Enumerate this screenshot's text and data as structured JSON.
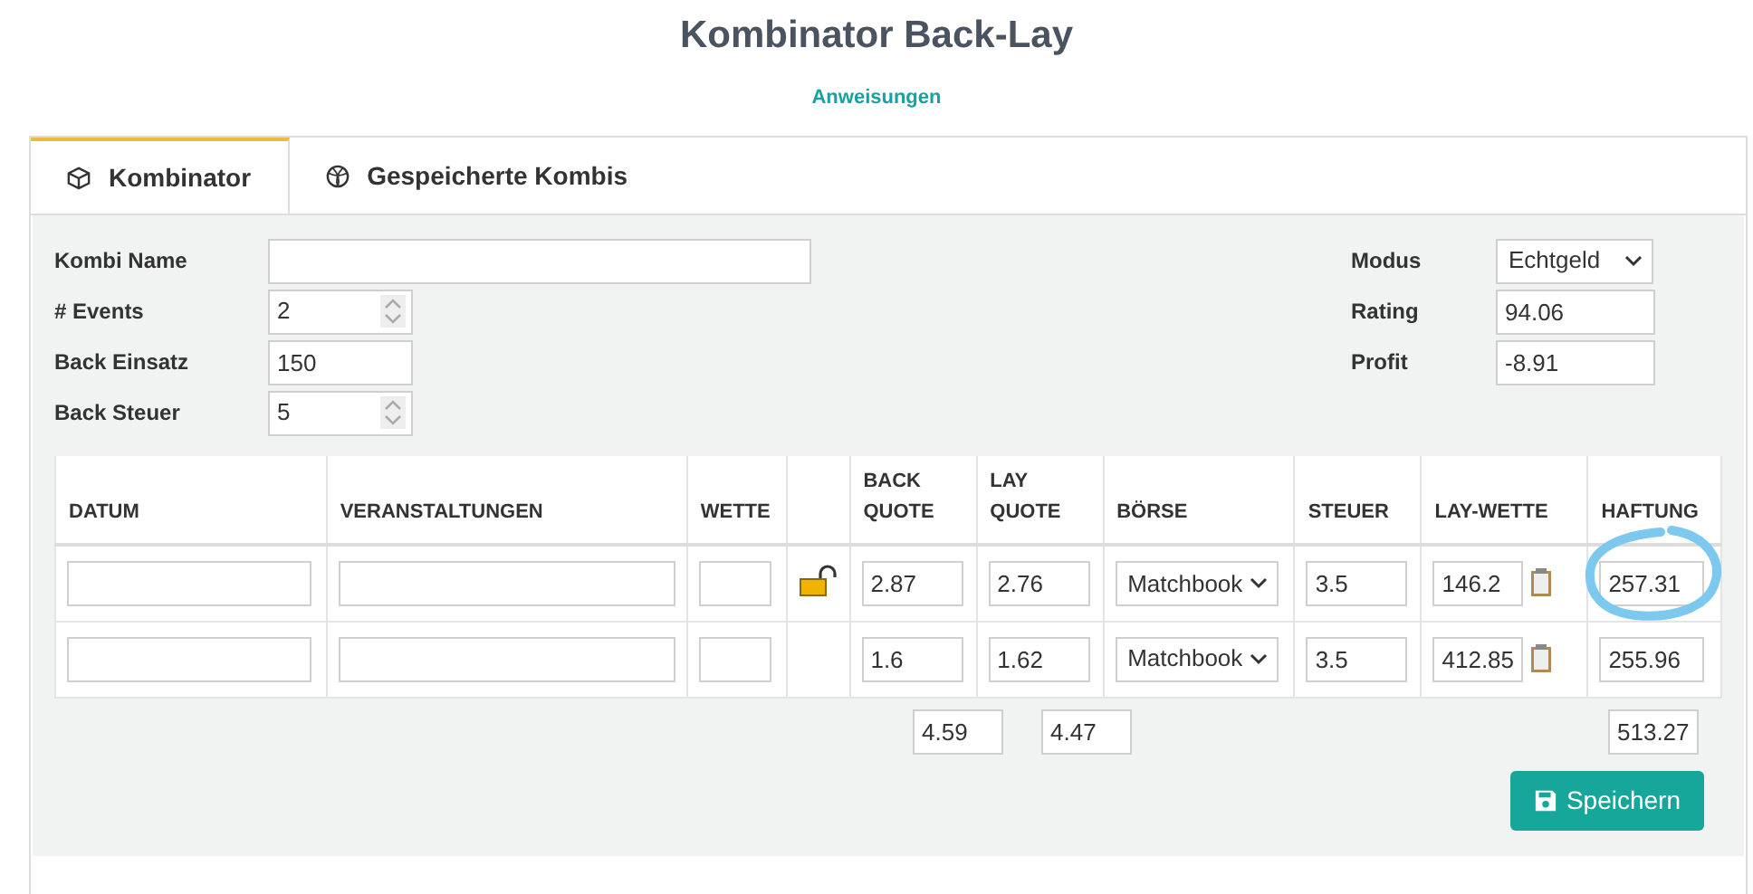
{
  "title": "Kombinator Back-Lay",
  "instructions_link": "Anweisungen",
  "tabs": [
    {
      "label": "Kombinator",
      "selected": true
    },
    {
      "label": "Gespeicherte Kombis",
      "selected": false
    }
  ],
  "form_left": [
    {
      "label": "Kombi Name",
      "kind": "text"
    },
    {
      "label": "# Events",
      "kind": "spinner",
      "value": "2"
    },
    {
      "label": "Back Einsatz",
      "kind": "text",
      "value": "150"
    },
    {
      "label": "Back Steuer",
      "kind": "spinner",
      "value": "5"
    }
  ],
  "form_right": [
    {
      "label": "Modus",
      "kind": "select",
      "value": "Echtgeld"
    },
    {
      "label": "Rating",
      "kind": "text",
      "value": "94.06"
    },
    {
      "label": "Profit",
      "kind": "text",
      "value": "-8.91"
    }
  ],
  "table": {
    "columns": [
      "DATUM",
      "VERANSTALTUNGEN",
      "WETTE",
      "",
      "BACK QUOTE",
      "LAY QUOTE",
      "BÖRSE",
      "STEUER",
      "LAY-WETTE",
      "HAFTUNG"
    ],
    "rows": [
      {
        "lock": true,
        "back_quote": "2.87",
        "lay_quote": "2.76",
        "boerse": "Matchbook",
        "steuer": "3.5",
        "lay_wette": "146.2",
        "haftung": "257.31",
        "circled": true
      },
      {
        "lock": false,
        "back_quote": "1.6",
        "lay_quote": "1.62",
        "boerse": "Matchbook",
        "steuer": "3.5",
        "lay_wette": "412.85",
        "haftung": "255.96",
        "circled": false
      }
    ],
    "totals": {
      "back_quote": "4.59",
      "lay_quote": "4.47",
      "haftung": "513.27"
    }
  },
  "save_button": "Speichern"
}
